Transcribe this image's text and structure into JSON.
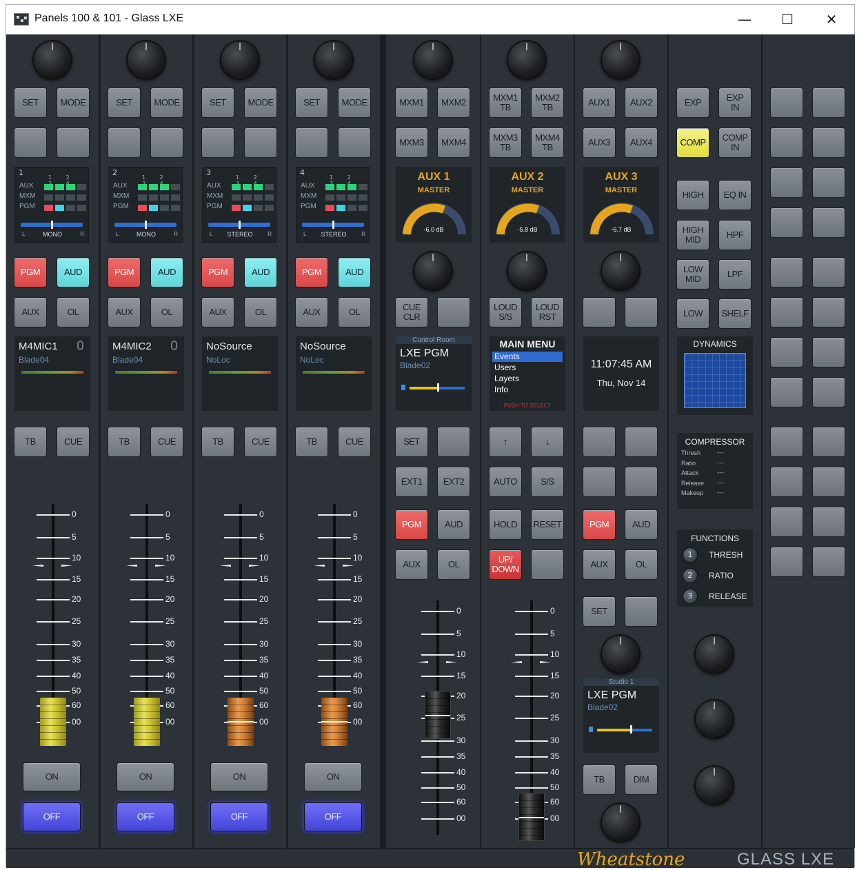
{
  "window": {
    "title": "Panels 100 & 101 - Glass LXE",
    "minimize": "—",
    "maximize": "☐",
    "close": "✕"
  },
  "input_strips": [
    {
      "num": "1",
      "mode_label": "MONO",
      "name": "M4MIC1",
      "location": "Blade04",
      "fader_color": "yellow",
      "has_mic": true
    },
    {
      "num": "2",
      "mode_label": "MONO",
      "name": "M4MIC2",
      "location": "Blade04",
      "fader_color": "yellow",
      "has_mic": true
    },
    {
      "num": "3",
      "mode_label": "STEREO",
      "name": "NoSource",
      "location": "NoLoc",
      "fader_color": "orange",
      "has_mic": false
    },
    {
      "num": "4",
      "mode_label": "STEREO",
      "name": "NoSource",
      "location": "NoLoc",
      "fader_color": "orange",
      "has_mic": false
    }
  ],
  "strip_labels": {
    "set": "SET",
    "mode": "MODE",
    "pgm": "PGM",
    "aud": "AUD",
    "aux": "AUX",
    "ol": "OL",
    "tb": "TB",
    "cue": "CUE",
    "on": "ON",
    "off": "OFF",
    "cols": "1 2 3 4",
    "row_aux": "AUX",
    "row_mxm": "MXM",
    "row_pgm": "PGM",
    "bal_l": "L",
    "bal_r": "R"
  },
  "fader_scale": [
    "0",
    "5",
    "10",
    "15",
    "20",
    "25",
    "30",
    "35",
    "40",
    "50",
    "60",
    "00"
  ],
  "mixminus_strip": {
    "buttons_top": [
      "MXM1",
      "MXM2",
      "MXM3",
      "MXM4"
    ],
    "aux_title": "AUX 1",
    "aux_sub": "MASTER",
    "aux_db": "-6.0 dB",
    "cue_clr": "CUE\nCLR",
    "cr_header": "Control Room",
    "cr_name": "LXE PGM",
    "cr_loc": "Blade02",
    "set": "SET",
    "ext1": "EXT1",
    "ext2": "EXT2",
    "pgm": "PGM",
    "aud": "AUD",
    "aux": "AUX",
    "ol": "OL"
  },
  "tb_strip": {
    "buttons_top": [
      "MXM1\nTB",
      "MXM2\nTB",
      "MXM3\nTB",
      "MXM4\nTB"
    ],
    "aux_title": "AUX 2",
    "aux_sub": "MASTER",
    "aux_db": "-5.8 dB",
    "loud_ss": "LOUD\nS/S",
    "loud_rst": "LOUD\nRST",
    "menu_title": "MAIN MENU",
    "menu_items": [
      "Events",
      "Users",
      "Layers",
      "Info"
    ],
    "menu_hint": "PUSH TO SELECT",
    "up": "↑",
    "down": "↓",
    "auto": "AUTO",
    "ss": "S/S",
    "hold": "HOLD",
    "reset": "RESET",
    "updown": "UP/\nDOWN"
  },
  "aux_strip": {
    "buttons_top": [
      "AUX1",
      "AUX2",
      "AUX3",
      "AUX4"
    ],
    "aux_title": "AUX 3",
    "aux_sub": "MASTER",
    "aux_db": "-6.7 dB",
    "time": "11:07:45 AM",
    "date": "Thu, Nov 14",
    "pgm": "PGM",
    "aud": "AUD",
    "aux": "AUX",
    "ol": "OL",
    "set": "SET",
    "st_header": "Studio 1",
    "st_name": "LXE PGM",
    "st_loc": "Blade02",
    "tb": "TB",
    "dim": "DIM"
  },
  "eq_strip": {
    "exp": "EXP",
    "exp_in": "EXP\nIN",
    "comp": "COMP",
    "comp_in": "COMP\nIN",
    "high": "HIGH",
    "eq_in": "EQ IN",
    "high_mid": "HIGH\nMID",
    "hpf": "HPF",
    "low_mid": "LOW\nMID",
    "lpf": "LPF",
    "low": "LOW",
    "shelf": "SHELF",
    "dynamics": "DYNAMICS",
    "compressor_title": "COMPRESSOR",
    "comp_params": [
      {
        "name": "Thresh",
        "value": "---"
      },
      {
        "name": "Ratio",
        "value": "---"
      },
      {
        "name": "Attack",
        "value": "---"
      },
      {
        "name": "Release",
        "value": "---"
      },
      {
        "name": "Makeup",
        "value": "---"
      }
    ],
    "functions_title": "FUNCTIONS",
    "functions": [
      {
        "num": "1",
        "name": "THRESH"
      },
      {
        "num": "2",
        "name": "RATIO"
      },
      {
        "num": "3",
        "name": "RELEASE"
      }
    ]
  },
  "footer": {
    "brand": "Wheatstone",
    "product": "GLASS LXE"
  },
  "colors": {
    "pgm": "#e05050",
    "aud": "#6adde0",
    "comp": "#e8e24a",
    "off": "#5050e6",
    "fader_yellow": "#d8cf40",
    "fader_orange": "#d98a3e",
    "meter_arc": "#e5a51c"
  }
}
